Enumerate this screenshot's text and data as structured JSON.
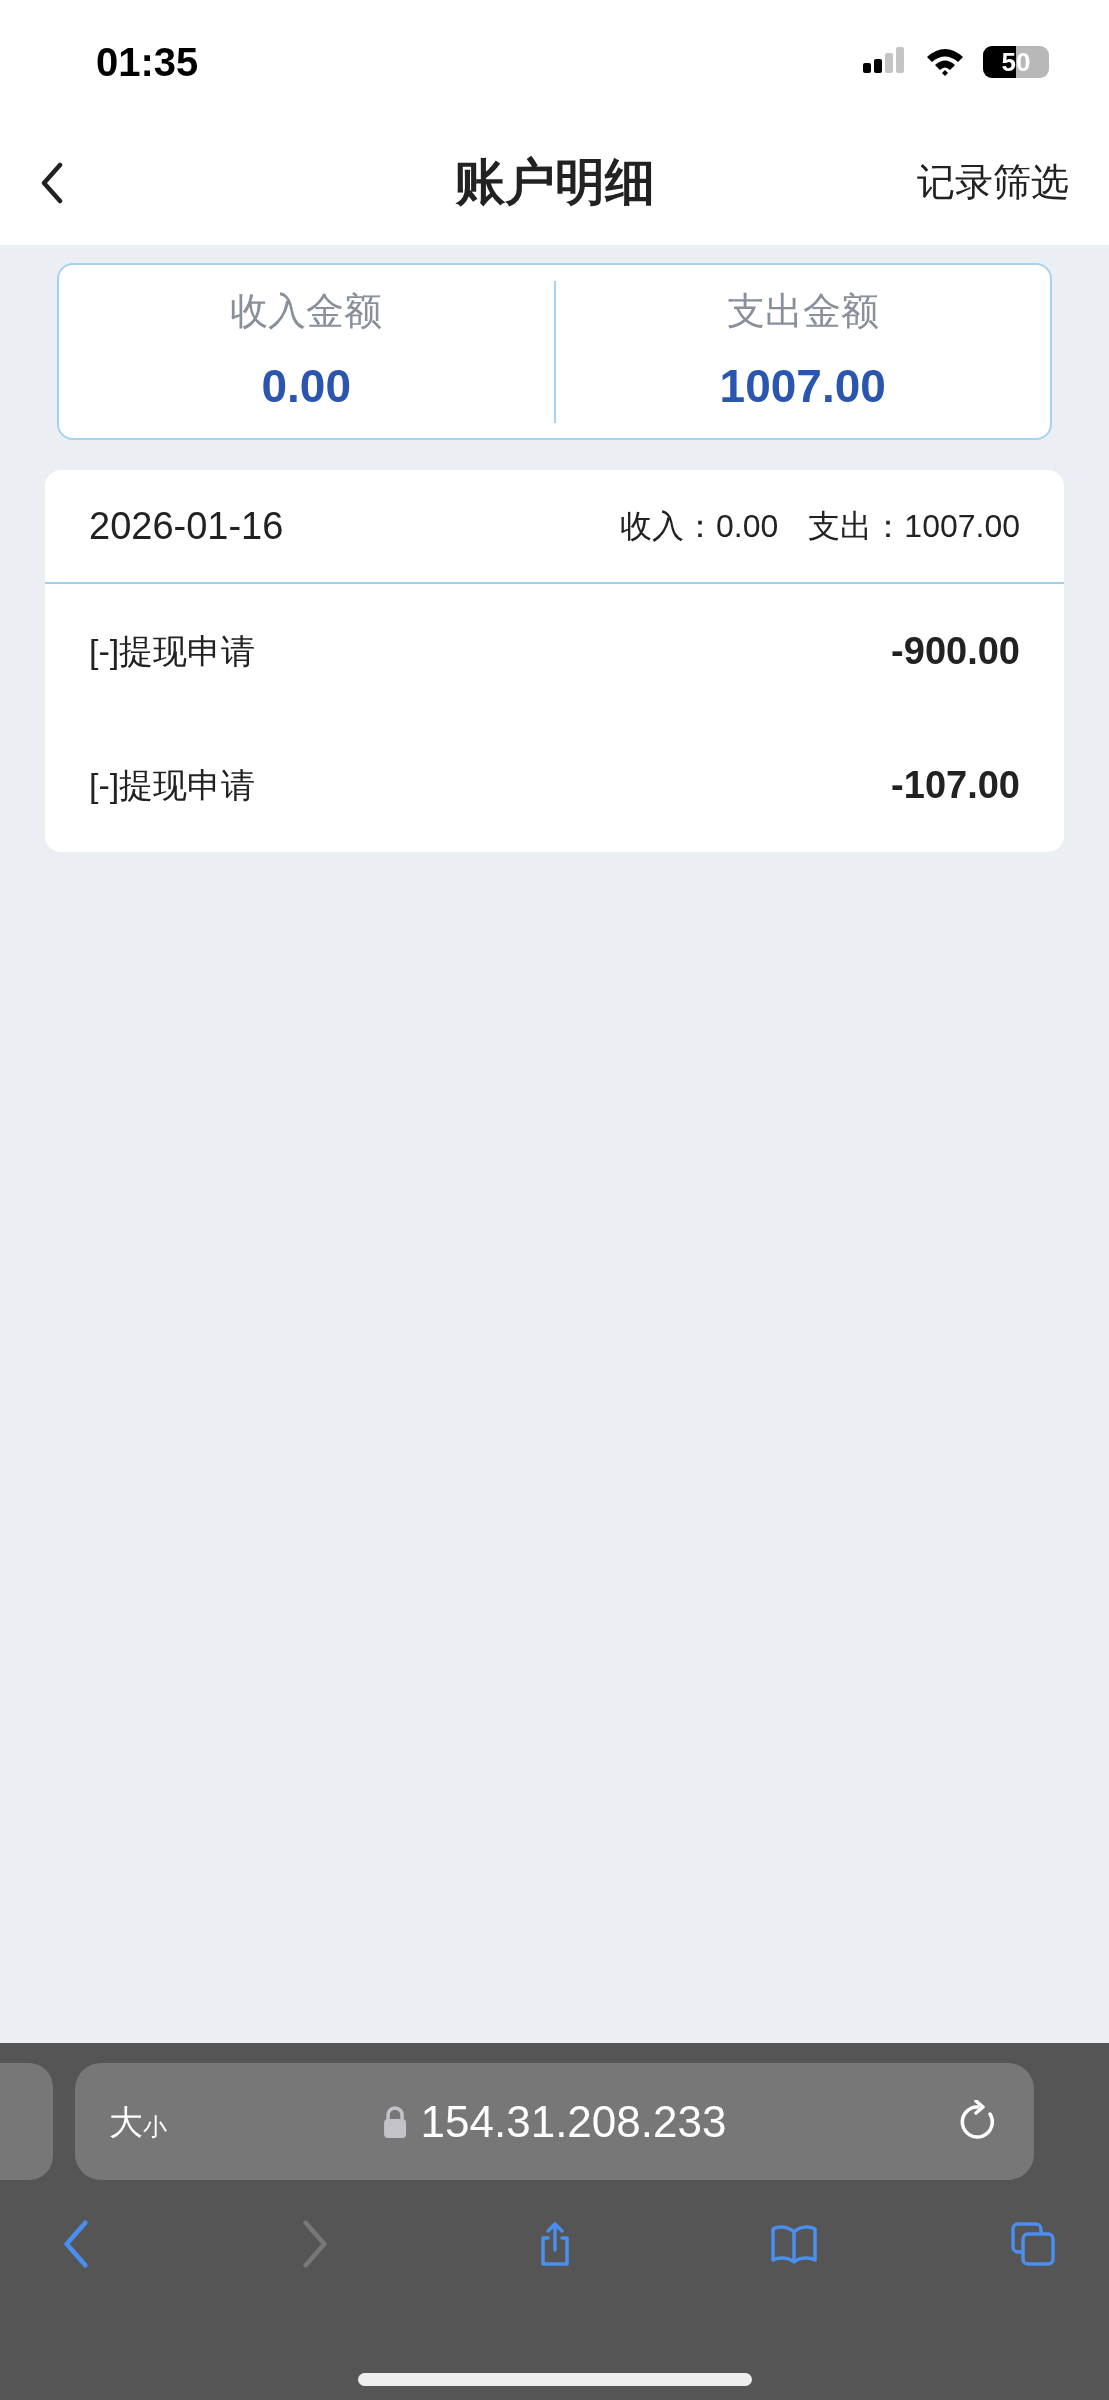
{
  "status_bar": {
    "time": "01:35",
    "battery": "50"
  },
  "header": {
    "title": "账户明细",
    "action": "记录筛选"
  },
  "summary": [
    {
      "label": "收入金额",
      "value": "0.00"
    },
    {
      "label": "支出金额",
      "value": "1007.00"
    }
  ],
  "day": {
    "date": "2026-01-16",
    "income_label": "收入：",
    "income": "0.00",
    "expense_label": "支出：",
    "expense": "1007.00",
    "rows": [
      {
        "label": "[-]提现申请",
        "amount": "-900.00"
      },
      {
        "label": "[-]提现申请",
        "amount": "-107.00"
      }
    ]
  },
  "browser": {
    "size_button": {
      "large": "大",
      "small": "小"
    },
    "address": "154.31.208.233",
    "nav": [
      {
        "kind": "back",
        "disabled": false
      },
      {
        "kind": "forward",
        "disabled": true
      },
      {
        "kind": "share",
        "disabled": false
      },
      {
        "kind": "bookmarks",
        "disabled": false
      },
      {
        "kind": "tabs",
        "disabled": false
      }
    ]
  }
}
